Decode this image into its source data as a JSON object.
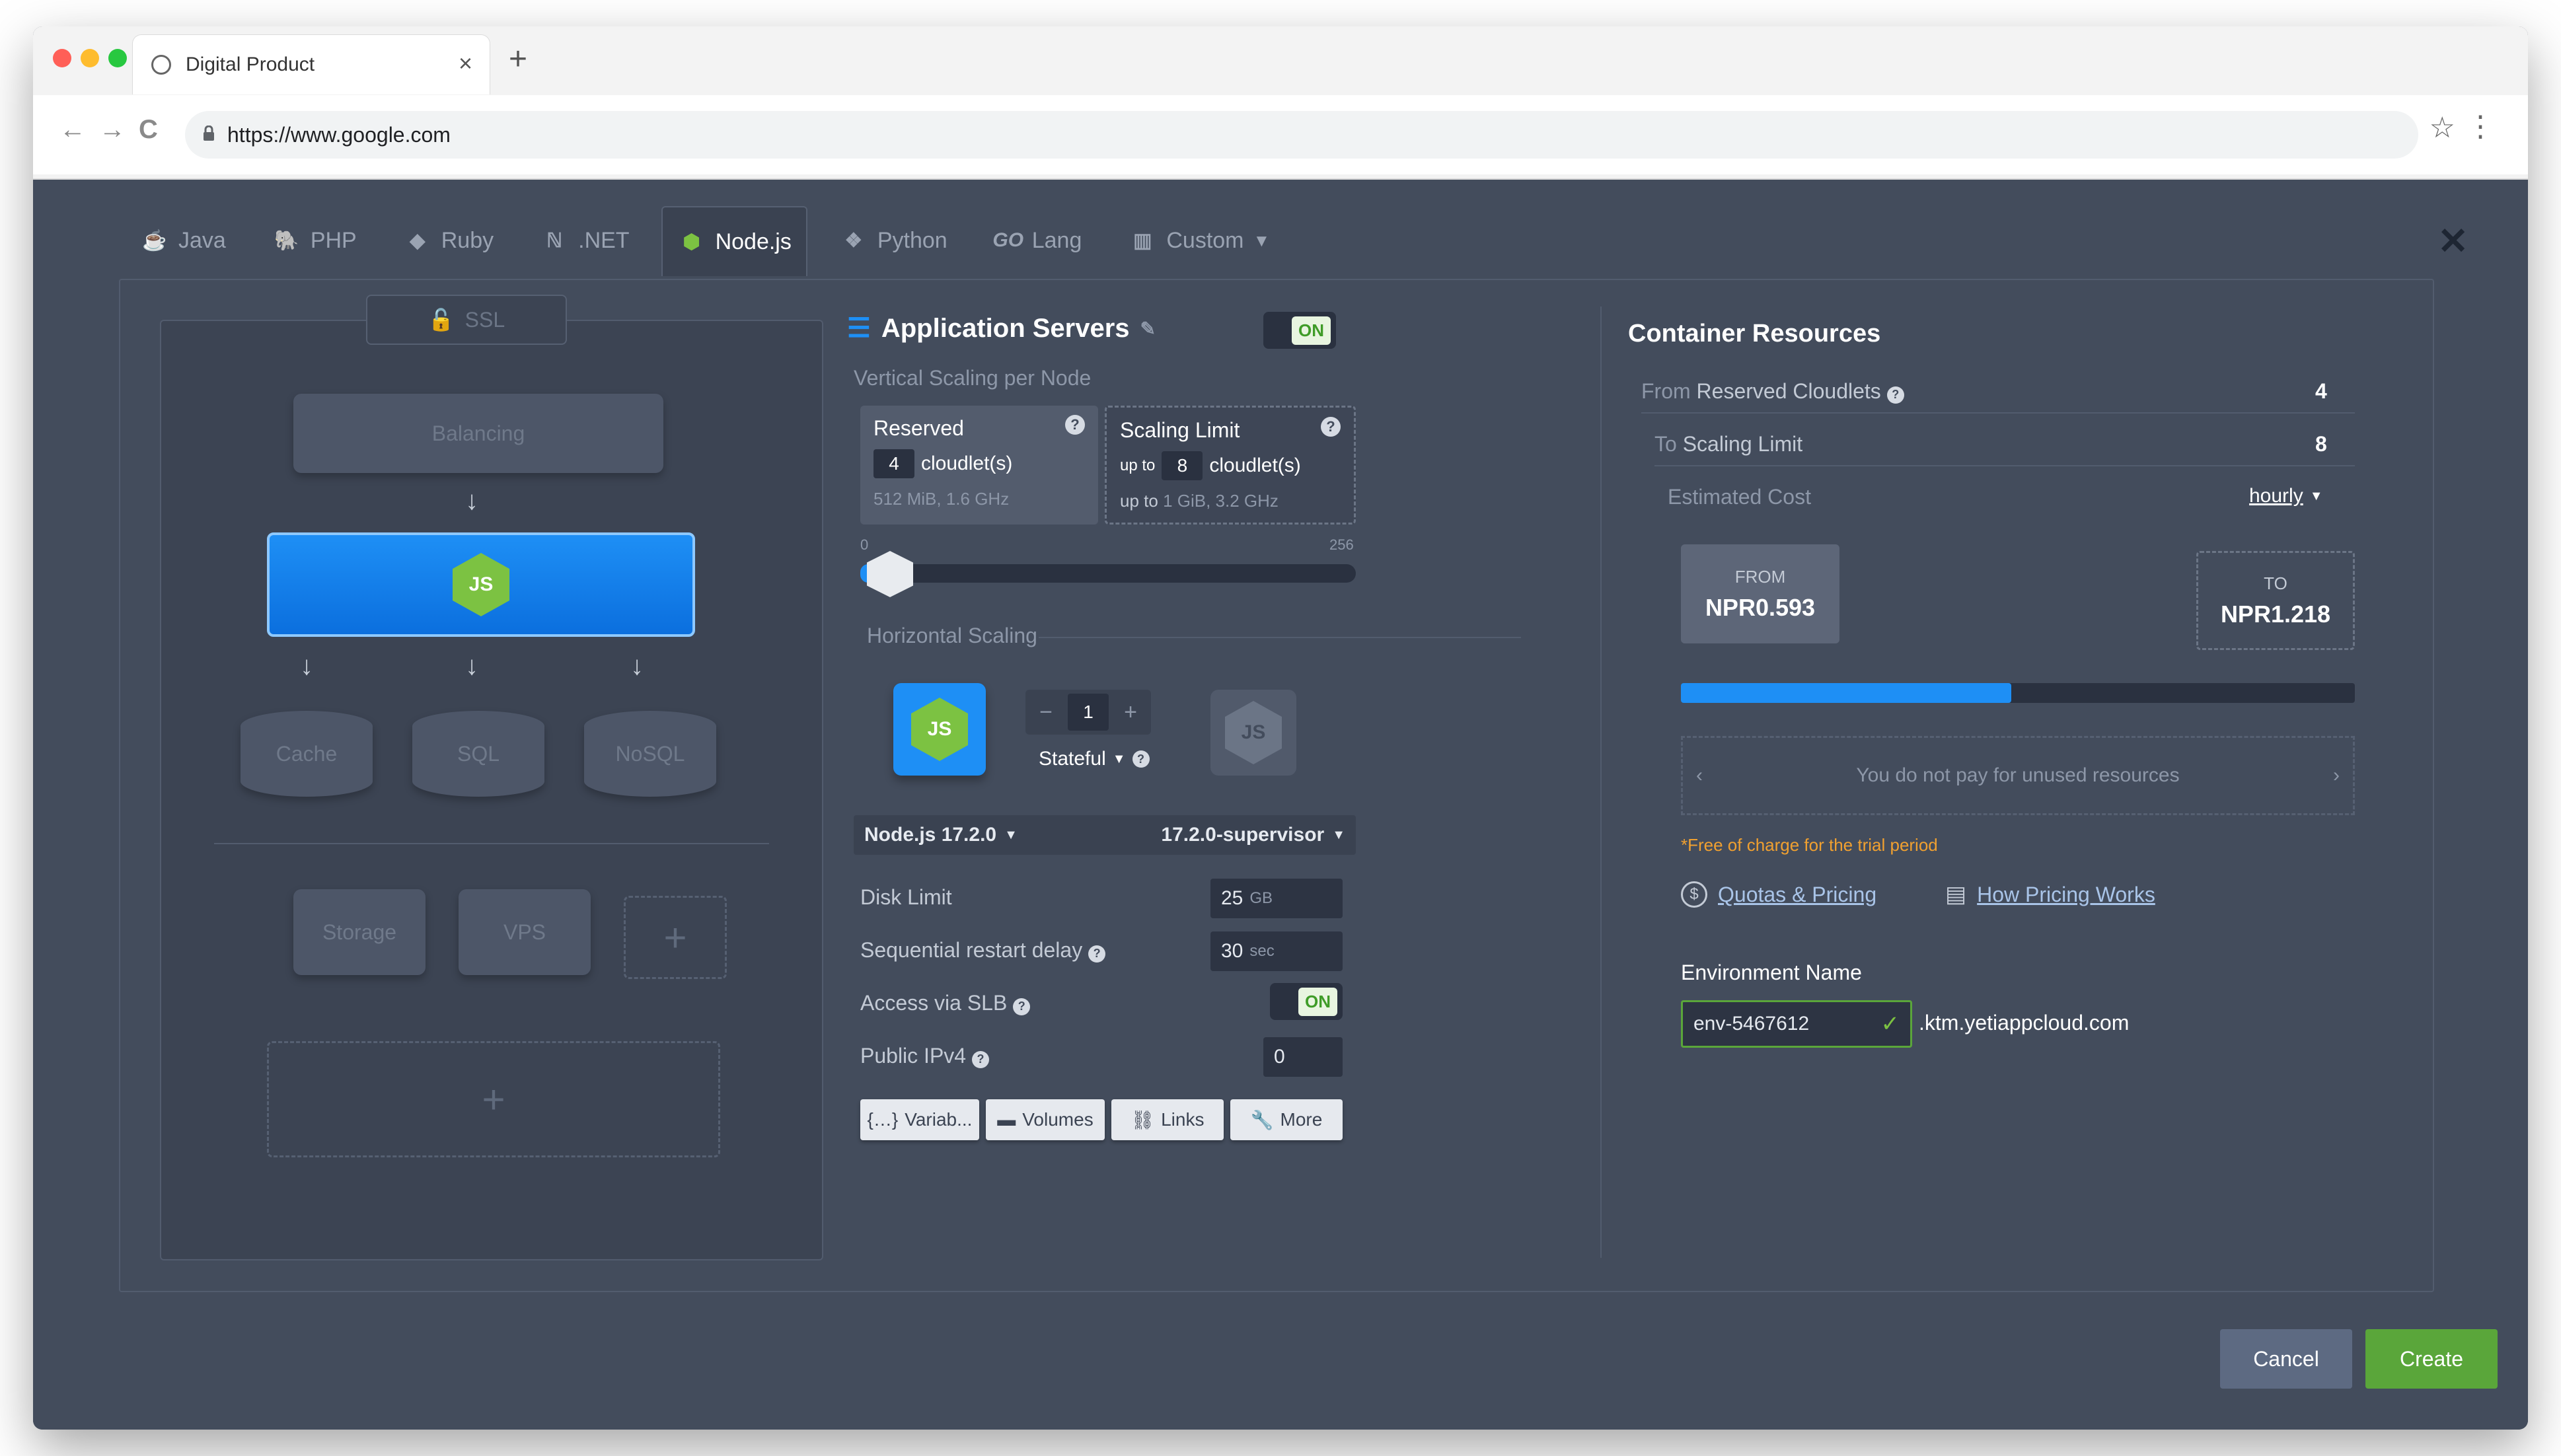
{
  "browser": {
    "tab_title": "Digital Product",
    "tab_close": "×",
    "new_tab": "+",
    "back": "←",
    "forward": "→",
    "reload": "C",
    "url": "https://www.google.com",
    "bookmark": "☆",
    "menu": "⋮"
  },
  "engine_tabs": [
    {
      "label": "Java",
      "icon": "java-icon",
      "glyph": "☕"
    },
    {
      "label": "PHP",
      "icon": "php-icon",
      "glyph": "🐘"
    },
    {
      "label": "Ruby",
      "icon": "ruby-icon",
      "glyph": "◆"
    },
    {
      "label": ".NET",
      "icon": "dotnet-icon",
      "glyph": "ℕ"
    },
    {
      "label": "Node.js",
      "icon": "nodejs-icon",
      "glyph": "⬢"
    },
    {
      "label": "Python",
      "icon": "python-icon",
      "glyph": "❖"
    },
    {
      "label": "Lang",
      "icon": "go-icon",
      "glyph": "GO"
    },
    {
      "label": "Custom",
      "icon": "custom-icon",
      "glyph": "▥"
    }
  ],
  "close_label": "✕",
  "topology": {
    "ssl": "SSL",
    "balancing": "Balancing",
    "nodejs_badge": "JS",
    "cache": "Cache",
    "sql": "SQL",
    "nosql": "NoSQL",
    "storage": "Storage",
    "vps": "VPS",
    "add": "+"
  },
  "config": {
    "title": "Application Servers",
    "on": "ON",
    "vertical_label": "Vertical Scaling per Node",
    "reserved_title": "Reserved",
    "reserved_value": "4",
    "reserved_unit": "cloudlet(s)",
    "reserved_spec": "512 MiB, 1.6 GHz",
    "limit_title": "Scaling Limit",
    "limit_prefix": "up to",
    "limit_value": "8",
    "limit_unit": "cloudlet(s)",
    "limit_spec_prefix": "up to",
    "limit_spec": "1 GiB, 3.2 GHz",
    "slider_min": "0",
    "slider_max": "256",
    "horizontal_label": "Horizontal Scaling",
    "node_count": "1",
    "minus": "−",
    "plus": "+",
    "stateful": "Stateful",
    "version": "Node.js 17.2.0",
    "tag": "17.2.0-supervisor",
    "disk_label": "Disk Limit",
    "disk_value": "25",
    "disk_unit": "GB",
    "restart_label": "Sequential restart delay",
    "restart_value": "30",
    "restart_unit": "sec",
    "slb_label": "Access via SLB",
    "slb_state": "ON",
    "ipv4_label": "Public IPv4",
    "ipv4_value": "0",
    "buttons": {
      "variables": "Variab...",
      "volumes": "Volumes",
      "links": "Links",
      "more": "More"
    }
  },
  "resources": {
    "title": "Container Resources",
    "from_prefix": "From",
    "reserved_label": "Reserved Cloudlets",
    "reserved_value": "4",
    "to_prefix": "To",
    "limit_label": "Scaling Limit",
    "limit_value": "8",
    "cost_label": "Estimated Cost",
    "cost_period": "hourly",
    "from_tag": "FROM",
    "from_price": "NPR0.593",
    "to_tag": "TO",
    "to_price": "NPR1.218",
    "reserved_fraction": 0.49,
    "unused_note": "You do not pay for unused resources",
    "trial_note": "*Free of charge for the trial period",
    "quotas_link": "Quotas & Pricing",
    "pricing_link": "How Pricing Works",
    "env_label": "Environment Name",
    "env_value": "env-5467612",
    "env_domain": ".ktm.yetiappcloud.com"
  },
  "footer": {
    "cancel": "Cancel",
    "create": "Create"
  },
  "colors": {
    "accent_blue": "#1e8ff5",
    "node_green": "#7cc242",
    "create_green": "#5aa63a",
    "cancel_gray": "#5d6a82",
    "trial_orange": "#f0a030"
  }
}
